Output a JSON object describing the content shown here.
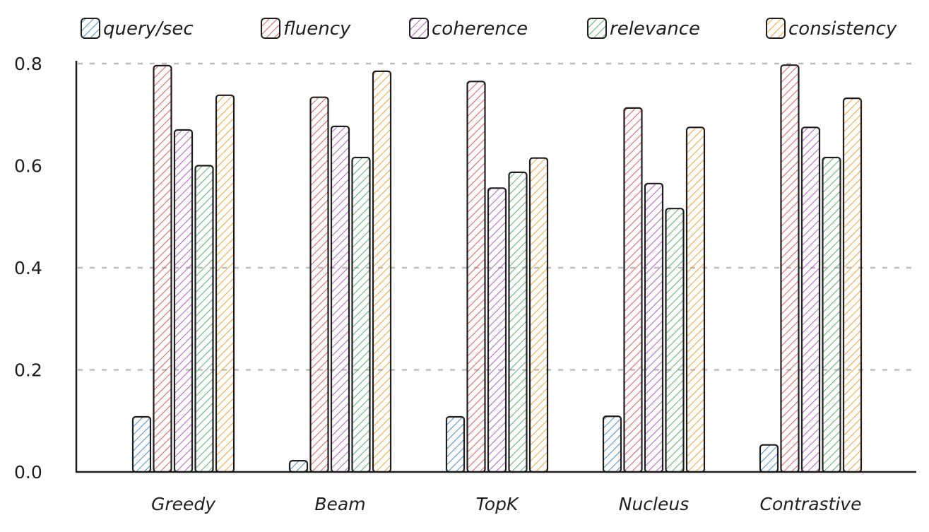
{
  "chart_data": {
    "type": "bar",
    "title": "",
    "xlabel": "",
    "ylabel": "",
    "ylim": [
      0,
      0.8
    ],
    "yticks": [
      0.0,
      0.2,
      0.4,
      0.6,
      0.8
    ],
    "ytick_labels": [
      "0.0",
      "0.2",
      "0.4",
      "0.6",
      "0.8"
    ],
    "gridlines_at": [
      0.2,
      0.4,
      0.8
    ],
    "grid": true,
    "legend_position": "top",
    "categories": [
      "Greedy",
      "Beam",
      "TopK",
      "Nucleus",
      "Contrastive"
    ],
    "series": [
      {
        "name": "query/sec",
        "color": "#1971c2",
        "values": [
          0.108,
          0.022,
          0.108,
          0.109,
          0.053
        ]
      },
      {
        "name": "fluency",
        "color": "#e03131",
        "values": [
          0.796,
          0.734,
          0.765,
          0.713,
          0.797
        ]
      },
      {
        "name": "coherence",
        "color": "#9c36b5",
        "values": [
          0.67,
          0.677,
          0.556,
          0.565,
          0.675
        ]
      },
      {
        "name": "relevance",
        "color": "#2f9e44",
        "values": [
          0.6,
          0.616,
          0.587,
          0.516,
          0.616
        ]
      },
      {
        "name": "consistency",
        "color": "#f08c00",
        "values": [
          0.738,
          0.785,
          0.615,
          0.675,
          0.732
        ]
      }
    ],
    "fill_style": "hachure",
    "outline_color": "#1e1e1e",
    "grid_color": "#bdbdbd"
  }
}
